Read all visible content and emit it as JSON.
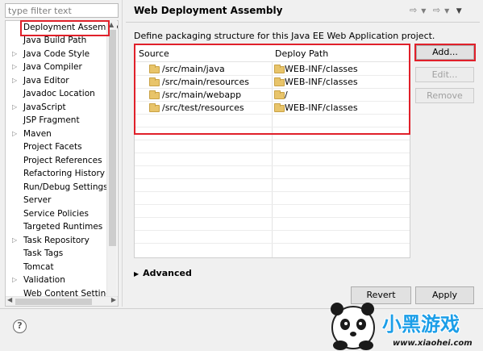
{
  "filter": {
    "placeholder": "type filter text"
  },
  "tree": {
    "items": [
      {
        "label": "Deployment Assembly",
        "expandable": false
      },
      {
        "label": "Java Build Path",
        "expandable": false
      },
      {
        "label": "Java Code Style",
        "expandable": true
      },
      {
        "label": "Java Compiler",
        "expandable": true
      },
      {
        "label": "Java Editor",
        "expandable": true
      },
      {
        "label": "Javadoc Location",
        "expandable": false
      },
      {
        "label": "JavaScript",
        "expandable": true
      },
      {
        "label": "JSP Fragment",
        "expandable": false
      },
      {
        "label": "Maven",
        "expandable": true
      },
      {
        "label": "Project Facets",
        "expandable": false
      },
      {
        "label": "Project References",
        "expandable": false
      },
      {
        "label": "Refactoring History",
        "expandable": false
      },
      {
        "label": "Run/Debug Settings",
        "expandable": false
      },
      {
        "label": "Server",
        "expandable": false
      },
      {
        "label": "Service Policies",
        "expandable": false
      },
      {
        "label": "Targeted Runtimes",
        "expandable": false
      },
      {
        "label": "Task Repository",
        "expandable": true
      },
      {
        "label": "Task Tags",
        "expandable": false
      },
      {
        "label": "Tomcat",
        "expandable": false
      },
      {
        "label": "Validation",
        "expandable": true
      },
      {
        "label": "Web Content Settings",
        "expandable": false
      }
    ]
  },
  "page": {
    "title": "Web Deployment Assembly",
    "description": "Define packaging structure for this Java EE Web Application project."
  },
  "table": {
    "headers": {
      "source": "Source",
      "deploy_path": "Deploy Path"
    },
    "rows": [
      {
        "source": "/src/main/java",
        "deploy_path": "WEB-INF/classes"
      },
      {
        "source": "/src/main/resources",
        "deploy_path": "WEB-INF/classes"
      },
      {
        "source": "/src/main/webapp",
        "deploy_path": "/"
      },
      {
        "source": "/src/test/resources",
        "deploy_path": "WEB-INF/classes"
      }
    ]
  },
  "buttons": {
    "add": "Add...",
    "edit": "Edit...",
    "remove": "Remove",
    "revert": "Revert",
    "apply": "Apply"
  },
  "advanced": {
    "label": "Advanced"
  },
  "watermark": {
    "brand": "小黑游戏",
    "url": "www.xiaohei.com"
  },
  "colors": {
    "highlight": "#e0202a",
    "watermark_blue": "#1c9ee8"
  }
}
